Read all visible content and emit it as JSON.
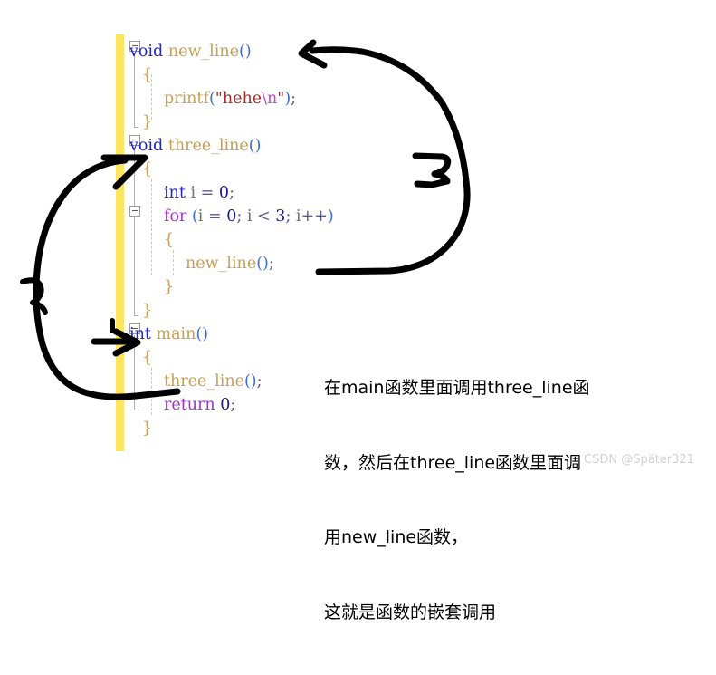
{
  "editor": {
    "code_lines": [
      {
        "indent": 0,
        "fold": true,
        "tokens": [
          {
            "t": "void",
            "c": "kw"
          },
          {
            "t": " ",
            "c": "plain"
          },
          {
            "t": "new_line",
            "c": "fn"
          },
          {
            "t": "()",
            "c": "punct"
          }
        ]
      },
      {
        "indent": 1,
        "fold": false,
        "tokens": [
          {
            "t": "{",
            "c": "brace"
          }
        ]
      },
      {
        "indent": 2,
        "fold": false,
        "tokens": [
          {
            "t": "printf",
            "c": "fn"
          },
          {
            "t": "(",
            "c": "punct"
          },
          {
            "t": "\"hehe",
            "c": "str"
          },
          {
            "t": "\\n",
            "c": "esc"
          },
          {
            "t": "\"",
            "c": "str"
          },
          {
            "t": ")",
            "c": "punct"
          },
          {
            "t": ";",
            "c": "semi"
          }
        ]
      },
      {
        "indent": 1,
        "fold": false,
        "tokens": [
          {
            "t": "}",
            "c": "brace"
          }
        ]
      },
      {
        "indent": 0,
        "fold": true,
        "tokens": [
          {
            "t": "void",
            "c": "kw"
          },
          {
            "t": " ",
            "c": "plain"
          },
          {
            "t": "three_line",
            "c": "fn"
          },
          {
            "t": "()",
            "c": "punct"
          }
        ]
      },
      {
        "indent": 1,
        "fold": false,
        "tokens": [
          {
            "t": "{",
            "c": "brace"
          }
        ]
      },
      {
        "indent": 2,
        "fold": false,
        "tokens": [
          {
            "t": "int",
            "c": "kw"
          },
          {
            "t": " ",
            "c": "plain"
          },
          {
            "t": "i",
            "c": "var"
          },
          {
            "t": " ",
            "c": "plain"
          },
          {
            "t": "=",
            "c": "op"
          },
          {
            "t": " ",
            "c": "plain"
          },
          {
            "t": "0",
            "c": "num"
          },
          {
            "t": ";",
            "c": "semi"
          }
        ]
      },
      {
        "indent": 2,
        "fold": true,
        "tokens": [
          {
            "t": "for",
            "c": "kwflow"
          },
          {
            "t": " ",
            "c": "plain"
          },
          {
            "t": "(",
            "c": "punct"
          },
          {
            "t": "i",
            "c": "var"
          },
          {
            "t": " ",
            "c": "plain"
          },
          {
            "t": "=",
            "c": "op"
          },
          {
            "t": " ",
            "c": "plain"
          },
          {
            "t": "0",
            "c": "num"
          },
          {
            "t": ";",
            "c": "semi"
          },
          {
            "t": " ",
            "c": "plain"
          },
          {
            "t": "i",
            "c": "var"
          },
          {
            "t": " ",
            "c": "plain"
          },
          {
            "t": "<",
            "c": "op"
          },
          {
            "t": " ",
            "c": "plain"
          },
          {
            "t": "3",
            "c": "num"
          },
          {
            "t": ";",
            "c": "semi"
          },
          {
            "t": " ",
            "c": "plain"
          },
          {
            "t": "i",
            "c": "var"
          },
          {
            "t": "++",
            "c": "op"
          },
          {
            "t": ")",
            "c": "punct"
          }
        ]
      },
      {
        "indent": 2,
        "fold": false,
        "tokens": [
          {
            "t": "{",
            "c": "brace"
          }
        ]
      },
      {
        "indent": 3,
        "fold": false,
        "tokens": [
          {
            "t": "new_line",
            "c": "fn"
          },
          {
            "t": "()",
            "c": "punct"
          },
          {
            "t": ";",
            "c": "semi"
          }
        ]
      },
      {
        "indent": 2,
        "fold": false,
        "tokens": [
          {
            "t": "}",
            "c": "brace"
          }
        ]
      },
      {
        "indent": 1,
        "fold": false,
        "tokens": [
          {
            "t": "}",
            "c": "brace"
          }
        ]
      },
      {
        "indent": 0,
        "fold": true,
        "tokens": [
          {
            "t": "int",
            "c": "kw"
          },
          {
            "t": " ",
            "c": "plain"
          },
          {
            "t": "main",
            "c": "fn"
          },
          {
            "t": "()",
            "c": "punct"
          }
        ]
      },
      {
        "indent": 1,
        "fold": false,
        "tokens": [
          {
            "t": "{",
            "c": "brace"
          }
        ]
      },
      {
        "indent": 2,
        "fold": false,
        "tokens": [
          {
            "t": "three_line",
            "c": "fn"
          },
          {
            "t": "()",
            "c": "punct"
          },
          {
            "t": ";",
            "c": "semi"
          }
        ]
      },
      {
        "indent": 2,
        "fold": false,
        "tokens": [
          {
            "t": "return",
            "c": "kwflow"
          },
          {
            "t": " ",
            "c": "plain"
          },
          {
            "t": "0",
            "c": "num"
          },
          {
            "t": ";",
            "c": "semi"
          }
        ]
      },
      {
        "indent": 1,
        "fold": false,
        "tokens": [
          {
            "t": "}",
            "c": "brace"
          }
        ]
      }
    ],
    "plain_code": [
      "void new_line()",
      "{",
      "    printf(\"hehe\\n\");",
      "}",
      "void three_line()",
      "{",
      "    int i = 0;",
      "    for (i = 0; i < 3; i++)",
      "    {",
      "        new_line();",
      "    }",
      "}",
      "int main()",
      "{",
      "    three_line();",
      "    return 0;",
      "}"
    ],
    "colors": {
      "change_bar": "#ffe45e",
      "keyword": "#2323c8",
      "control_keyword": "#a42fd0",
      "function": "#c8a055",
      "string": "#a02b2b",
      "escape": "#cc44cc",
      "background": "#ffffff"
    }
  },
  "annotation": {
    "lines": [
      "在main函数里面调用three_line函",
      "数，然后在three_line函数里面调",
      "用new_line函数，",
      "这就是函数的嵌套调用"
    ],
    "full_text": "在main函数里面调用three_line函数，然后在three_line函数里面调用new_line函数，这就是函数的嵌套调用",
    "color": "#000000"
  },
  "ink": {
    "color": "#000000",
    "marks": [
      {
        "name": "arrow-new-line-call-to-definition",
        "from": "new_line(); inside for loop",
        "to": "void new_line() definition"
      },
      {
        "name": "arrow-three-line-call-to-definition",
        "from": "three_line(); inside main",
        "to": "void three_line() definition"
      },
      {
        "name": "arrow-pointer-to-main",
        "from": "left margin",
        "to": "int main()"
      }
    ]
  },
  "watermark": {
    "text": "CSDN @Später321",
    "color": "#d2d2d2"
  }
}
